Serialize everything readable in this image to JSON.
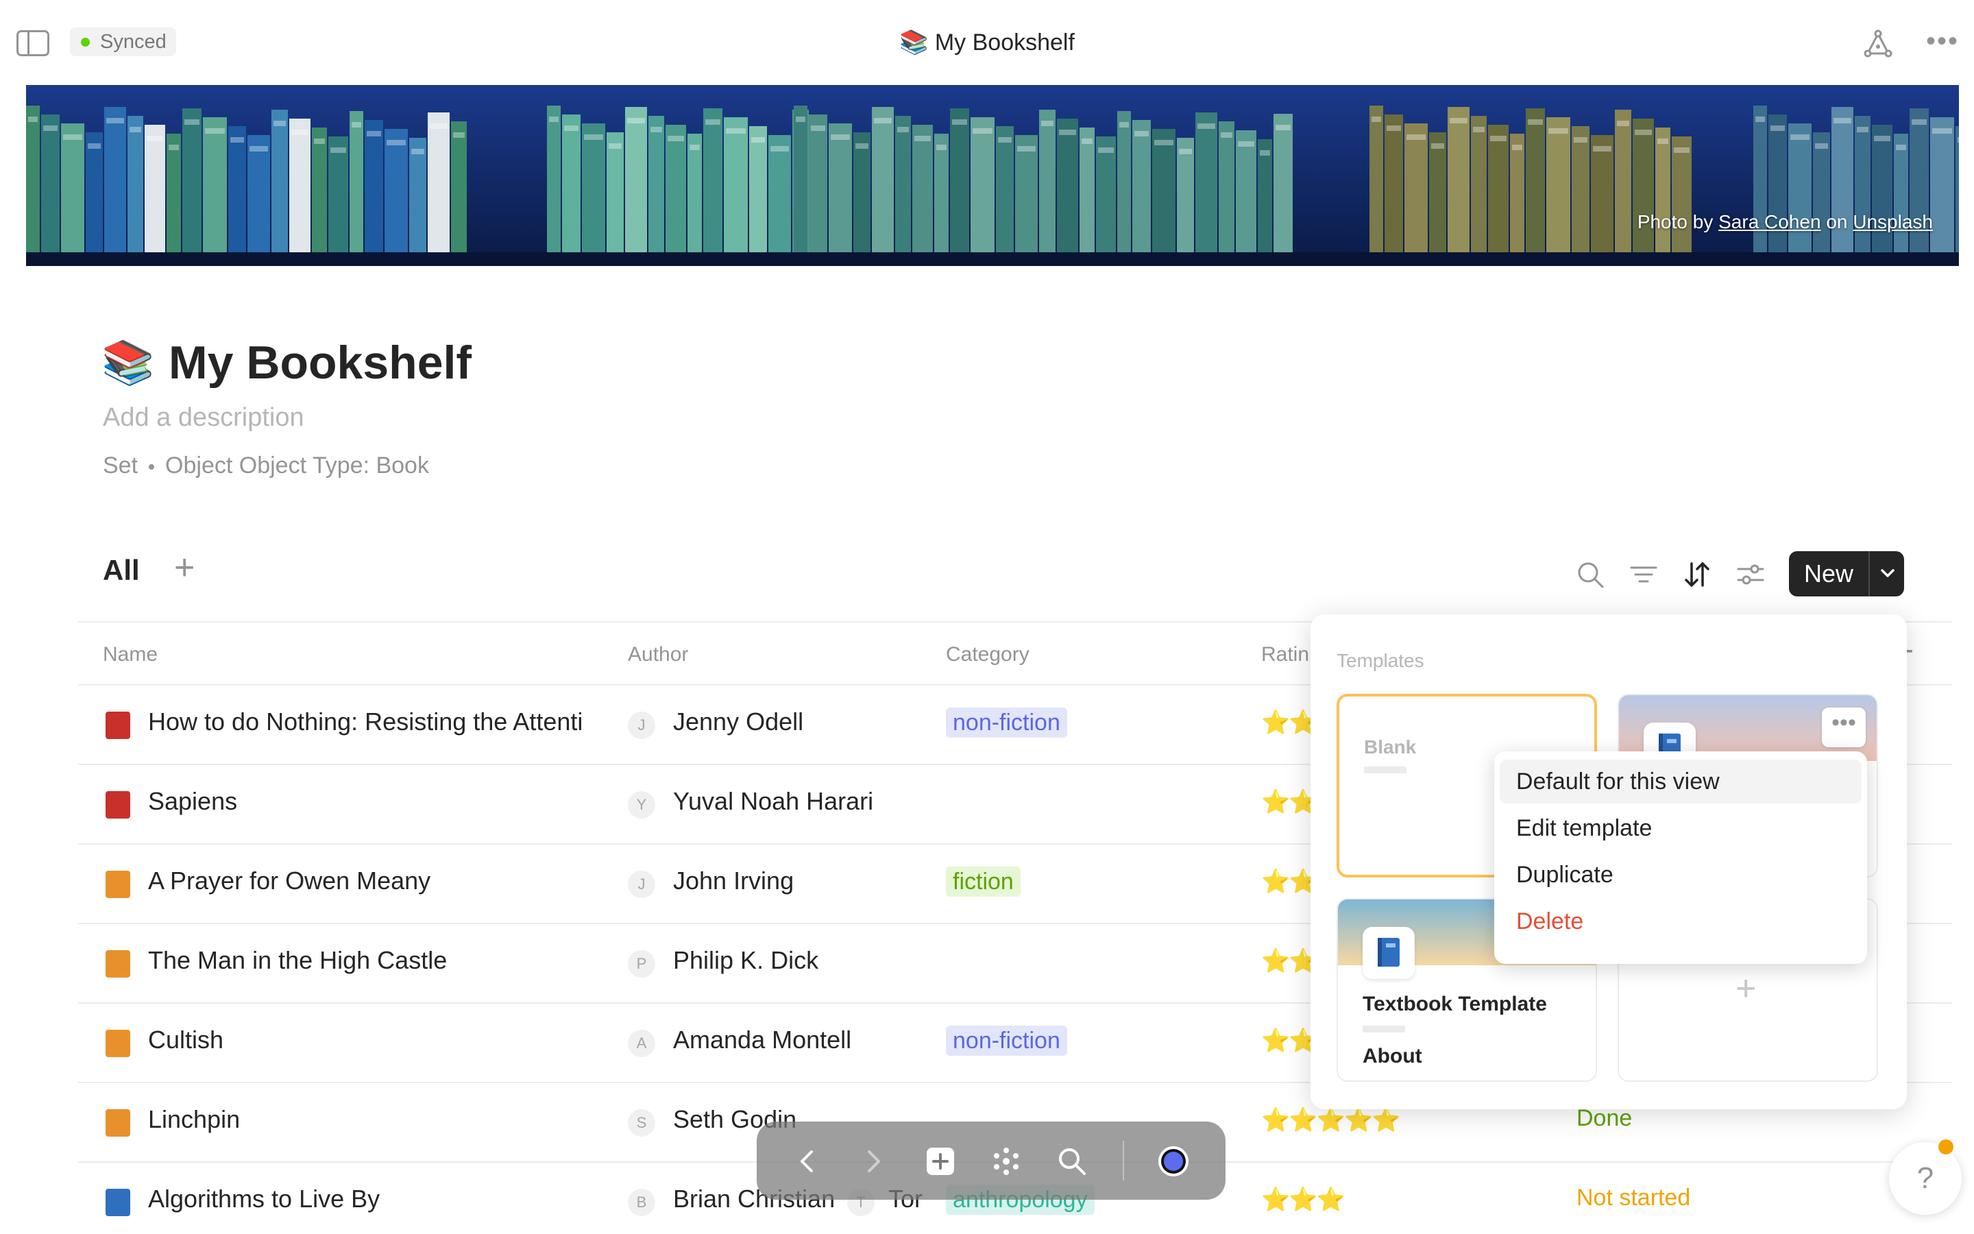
{
  "window": {
    "sync_status": "Synced",
    "title_emoji": "📚",
    "title": "My Bookshelf"
  },
  "cover": {
    "credit_prefix": "Photo by ",
    "credit_author": "Sara Cohen",
    "credit_mid": " on ",
    "credit_site": "Unsplash"
  },
  "page": {
    "emoji": "📚",
    "title": "My Bookshelf",
    "description_placeholder": "Add a description",
    "meta_type": "Set",
    "meta_source": "Object Object Type: Book"
  },
  "view": {
    "active_view": "All",
    "new_label": "New"
  },
  "table": {
    "columns": [
      "Name",
      "Author",
      "Category",
      "Ratin"
    ],
    "rows": [
      {
        "name": "How to do Nothing: Resisting the Attenti",
        "book_color": "#c8302c",
        "author_initial": "J",
        "author": "Jenny Odell",
        "category": "non-fiction",
        "rating": 2,
        "status": ""
      },
      {
        "name": "Sapiens",
        "book_color": "#c8302c",
        "author_initial": "Y",
        "author": "Yuval Noah Harari",
        "category": "",
        "rating": 2,
        "status": ""
      },
      {
        "name": "A Prayer for Owen Meany",
        "book_color": "#e8912c",
        "author_initial": "J",
        "author": "John Irving",
        "category": "fiction",
        "rating": 2,
        "status": ""
      },
      {
        "name": "The Man in the High Castle",
        "book_color": "#e8912c",
        "author_initial": "P",
        "author": "Philip K. Dick",
        "category": "",
        "rating": 2,
        "status": ""
      },
      {
        "name": "Cultish",
        "book_color": "#e8912c",
        "author_initial": "A",
        "author": "Amanda Montell",
        "category": "non-fiction",
        "rating": 2,
        "status": ""
      },
      {
        "name": "Linchpin",
        "book_color": "#e8912c",
        "author_initial": "S",
        "author": "Seth Godin",
        "category": "",
        "rating": 5,
        "status": "Done"
      },
      {
        "name": "Algorithms to Live By",
        "book_color": "#2f6fc0",
        "author_initial": "B",
        "author": "Brian Christian",
        "author2_initial": "T",
        "author2": "Tor",
        "category": "anthropology",
        "rating": 3,
        "status": "Not started"
      }
    ]
  },
  "templates": {
    "label": "Templates",
    "blank_label": "Blank",
    "textbook_title": "Textbook Template",
    "textbook_about": "About",
    "card_more_icon": "ellipsis-icon"
  },
  "context_menu": {
    "items": [
      "Default for this view",
      "Edit template",
      "Duplicate",
      "Delete"
    ],
    "delete_color": "#e34f35"
  },
  "help": {
    "label": "?"
  },
  "colors": {
    "accent": "#252525",
    "synced": "#5dd400",
    "status_done": "#5fa100",
    "status_not_started": "#f0a400"
  }
}
